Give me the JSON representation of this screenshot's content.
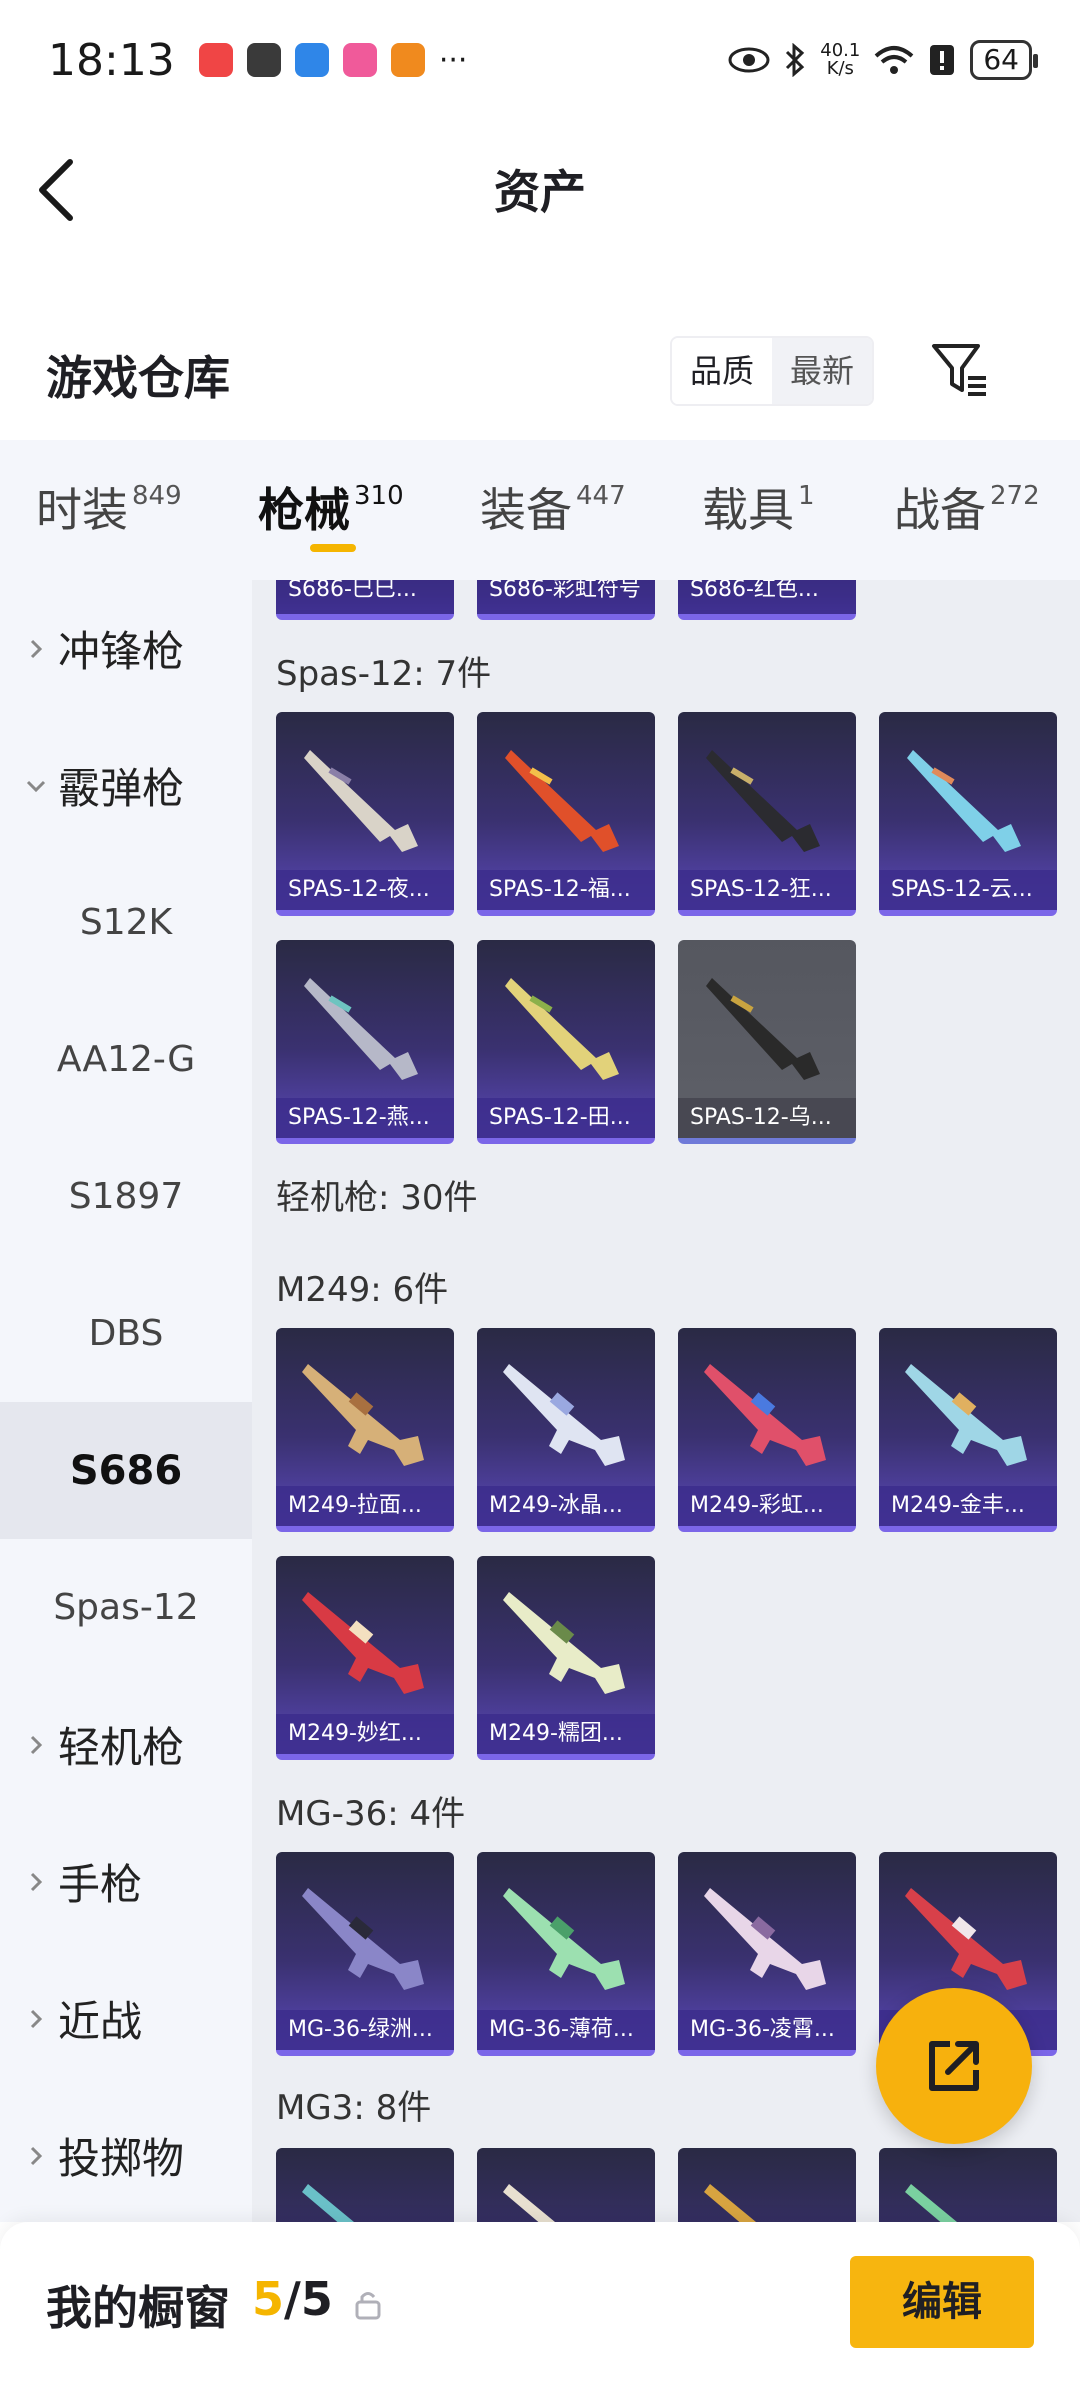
{
  "status_bar": {
    "time": "18:13",
    "more": "···",
    "net_speed_value": "40.1",
    "net_speed_unit": "K/s",
    "battery": "64",
    "app_icon_colors": [
      "#f04545",
      "#3a3a3a",
      "#2f86e8",
      "#f05a9a",
      "#f08a1e"
    ]
  },
  "nav": {
    "title": "资产"
  },
  "header": {
    "title": "游戏仓库",
    "sort_quality": "品质",
    "sort_newest": "最新"
  },
  "tabs": [
    {
      "label": "时装",
      "count": "849"
    },
    {
      "label": "枪械",
      "count": "310"
    },
    {
      "label": "装备",
      "count": "447"
    },
    {
      "label": "载具",
      "count": "1"
    },
    {
      "label": "战备",
      "count": "272"
    }
  ],
  "sidebar": [
    {
      "label": "冲锋枪",
      "type": "group",
      "expanded": false
    },
    {
      "label": "霰弹枪",
      "type": "group",
      "expanded": true
    },
    {
      "label": "S12K",
      "type": "sub"
    },
    {
      "label": "AA12-G",
      "type": "sub"
    },
    {
      "label": "S1897",
      "type": "sub"
    },
    {
      "label": "DBS",
      "type": "sub"
    },
    {
      "label": "S686",
      "type": "sub",
      "selected": true
    },
    {
      "label": "Spas-12",
      "type": "sub"
    },
    {
      "label": "轻机枪",
      "type": "group",
      "expanded": false
    },
    {
      "label": "手枪",
      "type": "group",
      "expanded": false
    },
    {
      "label": "近战",
      "type": "group",
      "expanded": false
    },
    {
      "label": "投掷物",
      "type": "group",
      "expanded": false
    }
  ],
  "sections": {
    "s686_items": [
      "S686-巳巳...",
      "S686-彩虹符号",
      "S686-红色..."
    ],
    "spas_title": "Spas-12: 7件",
    "spas_items": [
      "SPAS-12-夜...",
      "SPAS-12-福...",
      "SPAS-12-狂...",
      "SPAS-12-云...",
      "SPAS-12-燕...",
      "SPAS-12-田...",
      "SPAS-12-乌..."
    ],
    "lmg_title": "轻机枪: 30件",
    "m249_title": "M249: 6件",
    "m249_items": [
      "M249-拉面...",
      "M249-冰晶...",
      "M249-彩虹...",
      "M249-金丰...",
      "M249-妙红...",
      "M249-糯团..."
    ],
    "mg36_title": "MG-36: 4件",
    "mg36_items": [
      "MG-36-绿洲...",
      "MG-36-薄荷...",
      "MG-36-凌霄...",
      ""
    ],
    "mg3_title": "MG3: 8件"
  },
  "showcase": {
    "label": "我的橱窗",
    "current": "5",
    "separator": "/",
    "total": "5",
    "edit": "编辑"
  },
  "colors": {
    "accent": "#f7b50f",
    "card_top": "#2a2a44",
    "card_bottom": "#5a48b8"
  }
}
